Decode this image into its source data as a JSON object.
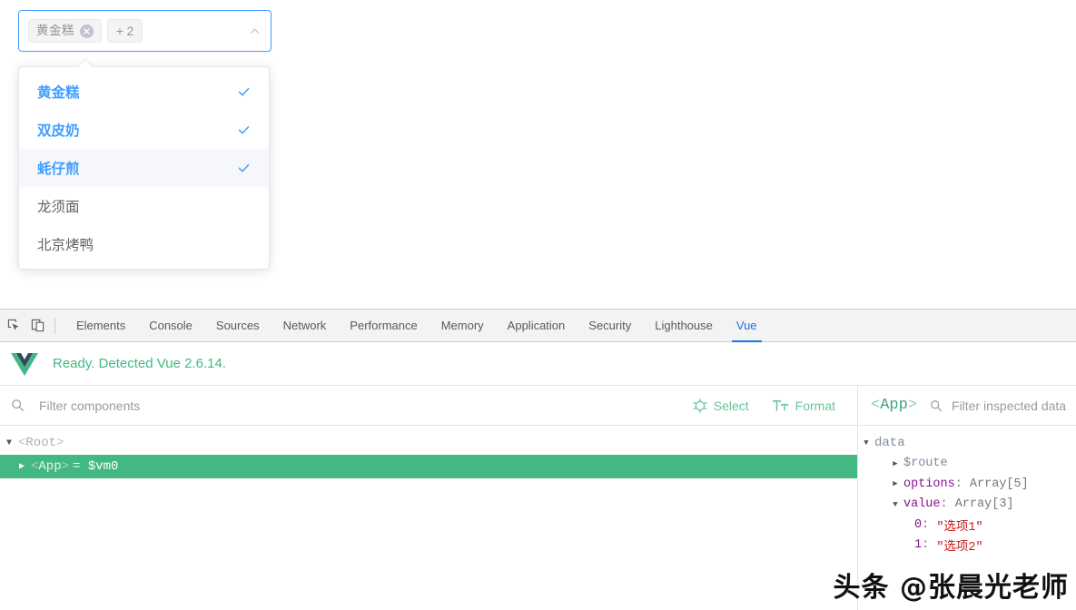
{
  "select": {
    "tags": [
      {
        "label": "黄金糕",
        "closable": true
      },
      {
        "label": "+ 2",
        "closable": false
      }
    ],
    "caret_icon": "chevron-up-icon",
    "border_color": "#409eff",
    "open": true
  },
  "dropdown": {
    "options": [
      {
        "label": "黄金糕",
        "selected": true,
        "hover": false
      },
      {
        "label": "双皮奶",
        "selected": true,
        "hover": false
      },
      {
        "label": "蚝仔煎",
        "selected": true,
        "hover": true
      },
      {
        "label": "龙须面",
        "selected": false,
        "hover": false
      },
      {
        "label": "北京烤鸭",
        "selected": false,
        "hover": false
      }
    ],
    "selected_color": "#409eff",
    "check_icon": "check-icon"
  },
  "devtools": {
    "left_icons": [
      {
        "name": "inspect-element-icon"
      },
      {
        "name": "device-toolbar-icon"
      }
    ],
    "tabs": [
      {
        "label": "Elements",
        "active": false
      },
      {
        "label": "Console",
        "active": false
      },
      {
        "label": "Sources",
        "active": false
      },
      {
        "label": "Network",
        "active": false
      },
      {
        "label": "Performance",
        "active": false
      },
      {
        "label": "Memory",
        "active": false
      },
      {
        "label": "Application",
        "active": false
      },
      {
        "label": "Security",
        "active": false
      },
      {
        "label": "Lighthouse",
        "active": false
      },
      {
        "label": "Vue",
        "active": true
      }
    ],
    "active_tab_color": "#1a73e8"
  },
  "vue": {
    "banner": {
      "logo_icon": "vue-logo-icon",
      "status_text": "Ready. Detected Vue 2.6.14.",
      "status_color": "#42b983"
    },
    "components_toolbar": {
      "search_icon": "search-icon",
      "filter_placeholder": "Filter components",
      "filter_value": "",
      "select_label": "Select",
      "select_icon": "target-select-icon",
      "format_label": "Format",
      "format_icon": "text-format-icon",
      "action_color": "#6ac297"
    },
    "tree": [
      {
        "caret": "▼",
        "open_bracket": "<",
        "name": "Root",
        "close_bracket": ">",
        "suffix": "",
        "selected": false,
        "indent": 0
      },
      {
        "caret": "▶",
        "open_bracket": "<",
        "name": "App",
        "close_bracket": ">",
        "suffix": "= $vm0",
        "selected": true,
        "indent": 1
      }
    ],
    "inspector": {
      "title_open": "<",
      "title_name": "App",
      "title_close": ">",
      "search_icon": "search-icon",
      "filter_placeholder": "Filter inspected data",
      "filter_value": "",
      "data_group_label": "data",
      "rows": [
        {
          "caret": "▶",
          "key": "$route",
          "type": "",
          "value": "",
          "indent": 1,
          "key_style": "plain"
        },
        {
          "caret": "▶",
          "key": "options",
          "type": "Array[5]",
          "value": "",
          "indent": 1,
          "key_style": "key"
        },
        {
          "caret": "▼",
          "key": "value",
          "type": "Array[3]",
          "value": "",
          "indent": 1,
          "key_style": "key"
        },
        {
          "caret": "",
          "key": "0",
          "type": "",
          "value": "\"选项1\"",
          "indent": 2,
          "key_style": "key"
        },
        {
          "caret": "",
          "key": "1",
          "type": "",
          "value": "\"选项2\"",
          "indent": 2,
          "key_style": "key"
        }
      ]
    }
  },
  "watermark": {
    "text": "头条 @张晨光老师"
  }
}
